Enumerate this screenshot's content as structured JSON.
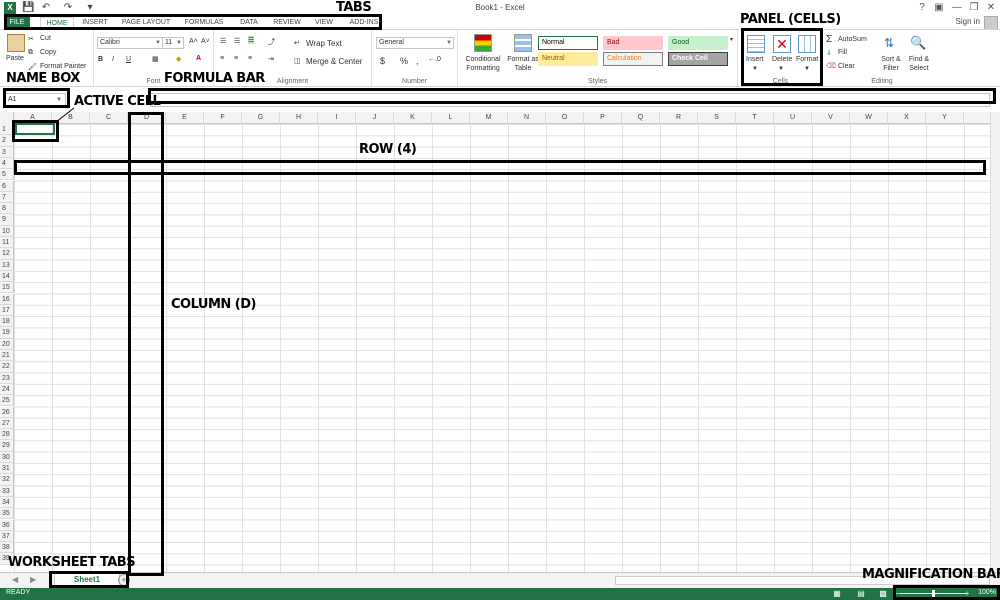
{
  "window": {
    "title": "Book1 - Excel",
    "help": "?",
    "signin": "Sign in"
  },
  "tabs": [
    "FILE",
    "HOME",
    "INSERT",
    "PAGE LAYOUT",
    "FORMULAS",
    "DATA",
    "REVIEW",
    "VIEW",
    "ADD-INS"
  ],
  "ribbon": {
    "clipboard": {
      "paste": "Paste",
      "cut": "Cut",
      "copy": "Copy",
      "format_painter": "Format Painter"
    },
    "font": {
      "label": "Font",
      "font_name": "Calibri",
      "font_size": "11",
      "bold": "B",
      "italic": "I",
      "underline": "U"
    },
    "alignment": {
      "label": "Alignment",
      "wrap_text": "Wrap Text",
      "merge_center": "Merge & Center"
    },
    "number": {
      "label": "Number",
      "format": "General",
      "currency": "$",
      "percent": "%",
      "comma": ","
    },
    "styles": {
      "label": "Styles",
      "conditional_formatting": "Conditional Formatting",
      "format_as_table": "Format as Table",
      "cells": [
        {
          "name": "Normal",
          "bg": "#ffffff",
          "fg": "#000000",
          "border": "#217346"
        },
        {
          "name": "Bad",
          "bg": "#ffc7ce",
          "fg": "#9c0006",
          "border": "#ffc7ce"
        },
        {
          "name": "Good",
          "bg": "#c6efce",
          "fg": "#006100",
          "border": "#c6efce"
        },
        {
          "name": "Neutral",
          "bg": "#ffeb9c",
          "fg": "#9c5700",
          "border": "#ffeb9c"
        },
        {
          "name": "Calculation",
          "bg": "#f2f2f2",
          "fg": "#fa7d00",
          "border": "#7f7f7f"
        },
        {
          "name": "Check Cell",
          "bg": "#a5a5a5",
          "fg": "#ffffff",
          "border": "#3f3f3f"
        }
      ]
    },
    "cells_group": {
      "label": "Cells",
      "insert": "Insert",
      "delete": "Delete",
      "format": "Format"
    },
    "editing": {
      "label": "Editing",
      "autosum": "AutoSum",
      "fill": "Fill",
      "clear": "Clear",
      "sort_filter": "Sort & Filter",
      "find_select": "Find & Select"
    }
  },
  "namebox": {
    "value": "A1"
  },
  "grid": {
    "columns": [
      "A",
      "B",
      "C",
      "D",
      "E",
      "F",
      "G",
      "H",
      "I",
      "J",
      "K",
      "L",
      "M",
      "N",
      "O",
      "P",
      "Q",
      "R",
      "S",
      "T",
      "U",
      "V",
      "W",
      "X",
      "Y"
    ],
    "rows": [
      "1",
      "2",
      "3",
      "4",
      "5",
      "6",
      "7",
      "8",
      "9",
      "10",
      "11",
      "12",
      "13",
      "14",
      "15",
      "16",
      "17",
      "18",
      "19",
      "20",
      "21",
      "22",
      "23",
      "24",
      "25",
      "26",
      "27",
      "28",
      "29",
      "30",
      "31",
      "32",
      "33",
      "34",
      "35",
      "36",
      "37",
      "38",
      "39"
    ]
  },
  "sheets": {
    "active": "Sheet1",
    "add": "+"
  },
  "status": {
    "text": "READY",
    "zoom": "100%"
  },
  "annotations": {
    "tabs": "TABS",
    "panel": "PANEL (CELLS)",
    "name_box": "NAME BOX",
    "formula_bar": "FORMULA BAR",
    "active_cell": "ACTIVE CELL",
    "row": "ROW (4)",
    "column": "COLUMN (D)",
    "worksheet_tabs": "WORKSHEET TABS",
    "magnification": "MAGNIFICATION BAR"
  }
}
